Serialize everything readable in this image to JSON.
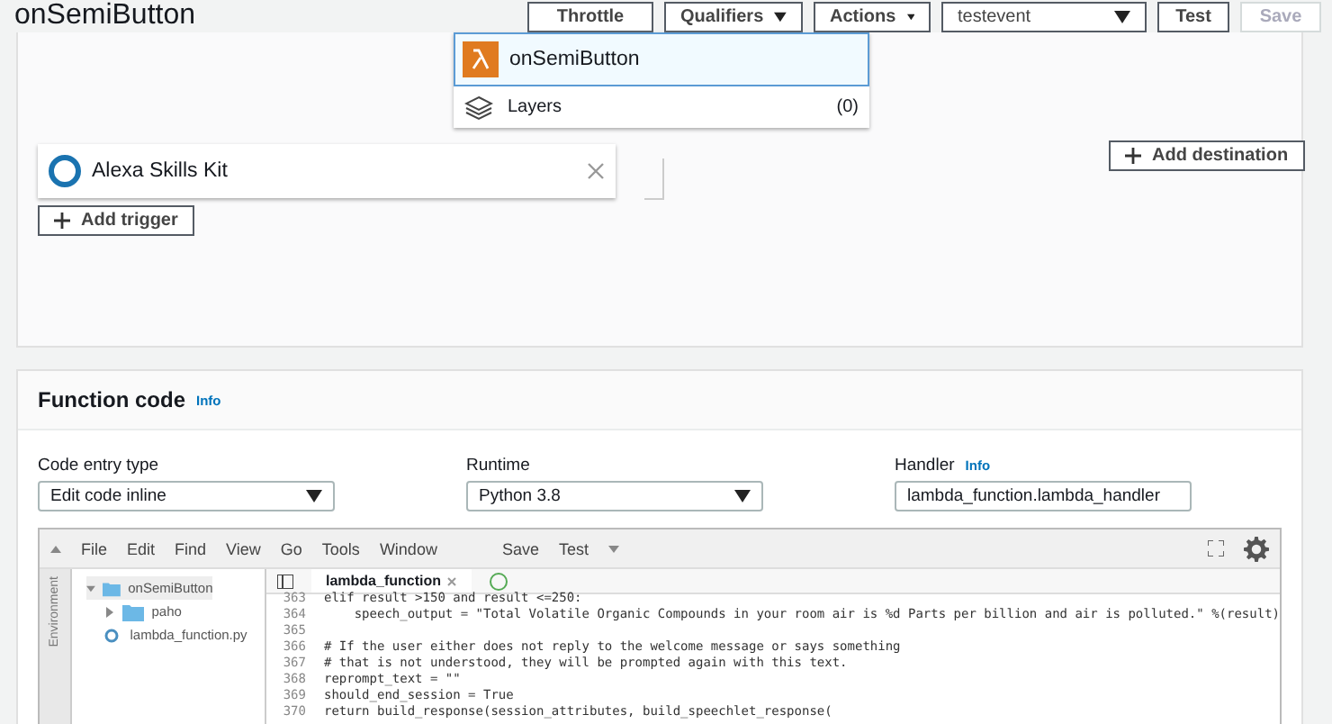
{
  "header": {
    "title": "onSemiButton",
    "buttons": [
      {
        "label": "Throttle",
        "kind": "plain",
        "disabled": false
      },
      {
        "label": "Qualifiers",
        "kind": "dropdown",
        "disabled": false
      },
      {
        "label": "Actions",
        "kind": "dropdown",
        "disabled": false
      },
      {
        "label": "testevent",
        "kind": "select",
        "disabled": false
      },
      {
        "label": "Test",
        "kind": "plain",
        "disabled": false
      },
      {
        "label": "Save",
        "kind": "plain",
        "disabled": true
      }
    ]
  },
  "designer": {
    "function_name": "onSemiButton",
    "layers_label": "Layers",
    "layers_count": "(0)",
    "trigger": "Alexa Skills Kit",
    "add_trigger": "Add trigger",
    "add_destination": "Add destination"
  },
  "function_code": {
    "title": "Function code",
    "info": "Info",
    "fields": [
      {
        "label": "Code entry type",
        "kind": "select",
        "value": "Edit code inline"
      },
      {
        "label": "Runtime",
        "kind": "select",
        "value": "Python 3.8"
      },
      {
        "label": "Handler",
        "kind": "input",
        "value": "lambda_function.lambda_handler",
        "info": "Info"
      }
    ],
    "editor": {
      "menu": [
        "File",
        "Edit",
        "Find",
        "View",
        "Go",
        "Tools",
        "Window"
      ],
      "save": "Save",
      "test": "Test",
      "side_label": "Environment",
      "tree": [
        {
          "label": "onSemiButton",
          "kind": "folder",
          "expanded": true,
          "children": [
            {
              "label": "paho",
              "kind": "folder",
              "expanded": false
            },
            {
              "label": "lambda_function.py",
              "kind": "file"
            }
          ]
        }
      ],
      "tab": "lambda_function",
      "lines": [
        {
          "number": "363",
          "code": "elif result >150 and result <=250:"
        },
        {
          "number": "364",
          "code": "    speech_output = \"Total Volatile Organic Compounds in your room air is %d Parts per billion and air is polluted.\" %(result)"
        },
        {
          "number": "365"
        },
        {
          "number": "366",
          "code": "# If the user either does not reply to the welcome message or says something"
        },
        {
          "number": "367",
          "code": "# that is not understood, they will be prompted again with this text."
        },
        {
          "number": "368",
          "code": "reprompt_text = \"\""
        },
        {
          "number": "369",
          "code": "should_end_session = True"
        },
        {
          "number": "370",
          "code": "return build_response(session_attributes, build_speechlet_response("
        }
      ]
    }
  }
}
